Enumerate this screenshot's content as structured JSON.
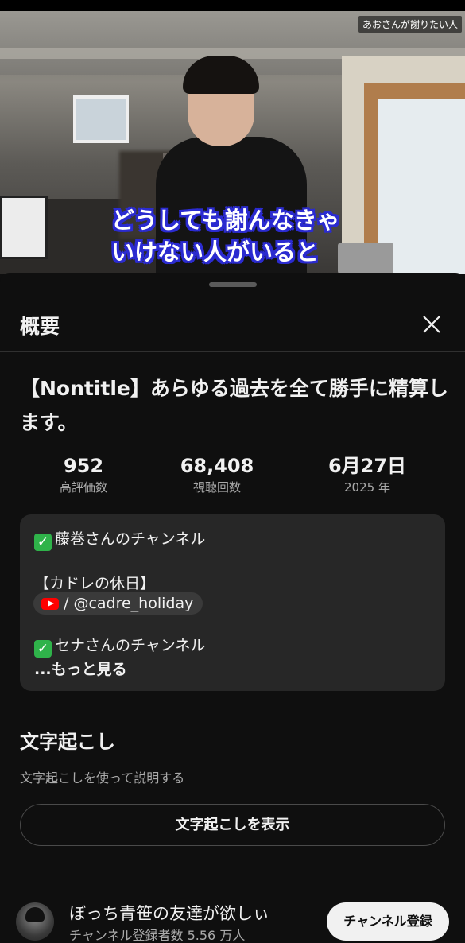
{
  "video": {
    "channel_watermark": "あおさんが謝りたい人",
    "caption_lines": [
      "どうしても謝んなきゃ",
      "いけない人がいると"
    ]
  },
  "sheet": {
    "title": "概要",
    "close_icon": "close-icon"
  },
  "video_info": {
    "title": "【Nontitle】あらゆる過去を全て勝手に精算します。",
    "stats": [
      {
        "value": "952",
        "label": "高評価数"
      },
      {
        "value": "68,408",
        "label": "視聴回数"
      },
      {
        "value": "6月27日",
        "label": "2025 年"
      }
    ]
  },
  "description": {
    "line1": "藤巻さんのチャンネル",
    "line2": "【カドレの休日】",
    "link_text": "/ @cadre_holiday",
    "line3": "セナさんのチャンネル",
    "more_label": "...もっと見る"
  },
  "transcript": {
    "title": "文字起こし",
    "subtitle": "文字起こしを使って説明する",
    "button_label": "文字起こしを表示"
  },
  "channel": {
    "name": "ぼっち青笹の友達が欲しぃ",
    "subscribers": "チャンネル登録者数 5.56 万人",
    "subscribe_label": "チャンネル登録"
  },
  "colors": {
    "background": "#0f0f0f",
    "card": "#272727",
    "text": "#f1f1f1",
    "secondary_text": "#aaaaaa",
    "caption_outline": "#2b2bd0",
    "check_green": "#2fb34a",
    "youtube_red": "#ff0000"
  }
}
